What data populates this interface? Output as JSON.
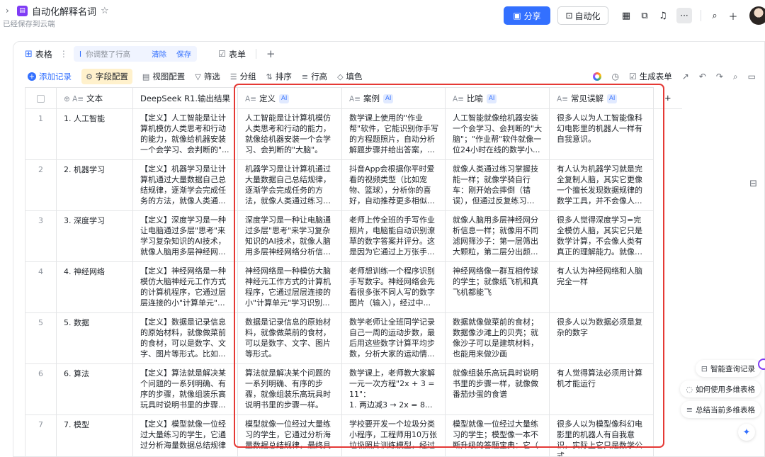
{
  "header": {
    "title": "自动化解释名词",
    "saved_status": "已经保存到云端",
    "share_label": "分享",
    "automation_label": "自动化"
  },
  "tabs": {
    "table_label": "表格",
    "pending_change": "你调整了行高",
    "clear_label": "清除",
    "save_label": "保存",
    "form_label": "表单"
  },
  "toolbar": {
    "add_record": "添加记录",
    "field_config": "字段配置",
    "view_config": "视图配置",
    "filter": "筛选",
    "group": "分组",
    "sort": "排序",
    "row_height": "行高",
    "fill_color": "填色",
    "generate_form": "生成表单"
  },
  "columns": [
    {
      "label": "文本",
      "ai": ""
    },
    {
      "label": "DeepSeek R1.输出结果",
      "ai": ""
    },
    {
      "label": "定义",
      "ai": "AI"
    },
    {
      "label": "案例",
      "ai": "AI"
    },
    {
      "label": "比喻",
      "ai": "AI"
    },
    {
      "label": "常见误解",
      "ai": "AI"
    }
  ],
  "rows": [
    {
      "num": "1",
      "term": "1. 人工智能",
      "output": "【定义】人工智能是让计算机模仿人类思考和行动的能力，就像给机器安装一个会学习、会判断的\"...",
      "definition": "人工智能是让计算机模仿人类思考和行动的能力，就像给机器安装一个会学习、会判断的\"大脑\"。",
      "example": "数学课上使用的\"作业帮\"软件，它能识别你手写的方程题照片，自动分析解题步骤并给出答案，就...",
      "metaphor": "人工智能就像给机器安装一个会学习、会判断的\"大脑\"；\"作业帮\"软件就像一位24小时在线的数学小...",
      "misconception": "很多人以为人工智能像科幻电影里的机器人一样有自我意识。"
    },
    {
      "num": "2",
      "term": "2. 机器学习",
      "output": "【定义】机器学习是让计算机通过大量数据自己总结规律，逐渐学会完成任务的方法，就像人类通...",
      "definition": "机器学习是让计算机通过大量数据自己总结规律，逐渐学会完成任务的方法，就像人类通过练习掌...",
      "example": "抖音App会根据你平时爱看的视频类型（比如宠物、篮球），分析你的喜好，自动推荐更多相似内...",
      "metaphor": "就像人类通过练习掌握技能一样；就像学骑自行车：刚开始会摔倒（错误），但通过反复练习（处...",
      "misconception": "有人认为机器学习就是完全复制人脑，其实它更像一个擅长发现数据规律的数学工具，并不会像人..."
    },
    {
      "num": "3",
      "term": "3. 深度学习",
      "output": "【定义】深度学习是一种让电脑通过多层\"思考\"来学习复杂知识的AI技术，就像人脑用多层神经网...",
      "definition": "深度学习是一种让电脑通过多层\"思考\"来学习复杂知识的AI技术，就像人脑用多层神经网络分析信息...",
      "example": "老师上传全班的手写作业照片，电脑能自动识别潦草的数字答案并评分。这是因为它通过上万张手...",
      "metaphor": "就像人脑用多层神经网分析信息一样；就像用不同滤网筛沙子：第一层筛出大颗粒，第二层分出颜...",
      "misconception": "很多人觉得深度学习=完全模仿人脑，其实它只是数学计算，不会像人类有真正的理解能力。就像计..."
    },
    {
      "num": "4",
      "term": "4. 神经网络",
      "output": "【定义】神经网络是一种模仿大脑神经元工作方式的计算机程序，它通过层层连接的小\"计算单元\"...",
      "definition": "神经网络是一种模仿大脑神经元工作方式的计算机程序，它通过层层连接的小\"计算单元\"学习识别...",
      "example": "老师想训练一个程序识别手写数字。神经网络会先看很多张不同人写的数字图片（输入），经过中...",
      "metaphor": "神经网络像一群互相传球的学生；就像纸飞机和真飞机都能飞",
      "misconception": "有人认为神经网络和人脑完全一样"
    },
    {
      "num": "5",
      "term": "5. 数据",
      "output": "【定义】数据是记录信息的原始材料，就像做菜前的食材，可以是数字、文字、图片等形式。比如...",
      "definition": "数据是记录信息的原始材料，就像做菜前的食材，可以是数字、文字、图片等形式。",
      "example": "数学老师让全班同学记录自己一周的运动步数，最后用这些数字计算平均步数，分析大家的运动情...",
      "metaphor": "数据就像做菜前的食材；数据像沙滩上的贝壳；就像沙子可以是建筑材料，也能用来做沙画",
      "misconception": "很多人以为数据必须是复杂的数字"
    },
    {
      "num": "6",
      "term": "6. 算法",
      "output": "【定义】算法就是解决某个问题的一系列明确、有序的步骤，就像组装乐高玩具时说明书里的步骤...",
      "definition": "算法就是解决某个问题的一系列明确、有序的步骤，就像组装乐高玩具时说明书里的步骤一样。",
      "example": "数学课上，老师教大家解一元一次方程\"2x + 3 = 11\"：\n1. 两边减3 → 2x = 8...",
      "metaphor": "就像组装乐高玩具时说明书里的步骤一样，就像做番茄炒蛋的食谱",
      "misconception": "有人觉得算法必须用计算机才能运行"
    },
    {
      "num": "7",
      "term": "7. 模型",
      "output": "【定义】模型就像一位经过大量练习的学生，它通过分析海量数据总结规律",
      "definition": "模型就像一位经过大量练习的学生，它通过分析海量数据总结规律，最终具",
      "example": "学校要开发一个垃圾分类小程序，工程师用10万张垃圾照片训练模型，经过",
      "metaphor": "模型就像一位经过大量练习的学生；模型像一本不断升级的答题宝典：它（",
      "misconception": "很多人以为模型像科幻电影里的机器人有自我意识，实际上它只是数学公式"
    }
  ],
  "floating": {
    "smart_query": "智能查询记录",
    "how_to_use": "如何使用多维表格",
    "summarize": "总结当前多维表格"
  }
}
